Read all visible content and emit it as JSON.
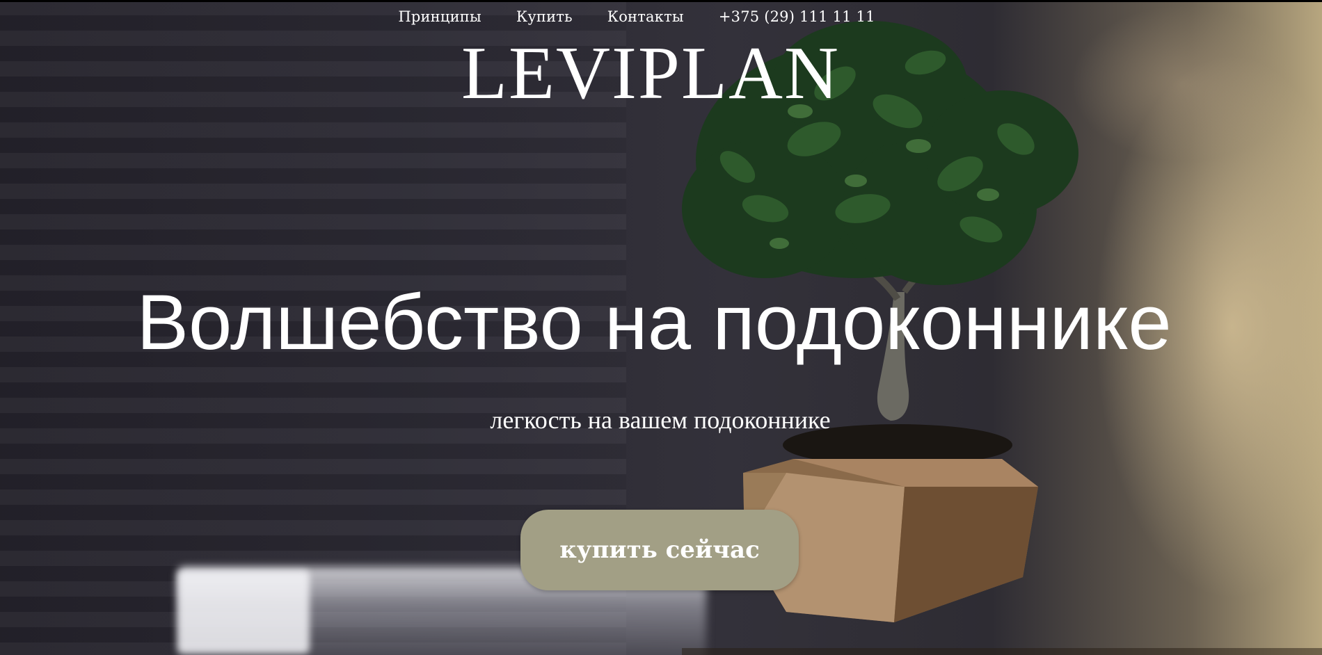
{
  "nav": {
    "items": [
      {
        "label": "Принципы"
      },
      {
        "label": "Купить"
      },
      {
        "label": "Контакты"
      }
    ],
    "phone": "+375 (29) 111 11 11"
  },
  "logo": {
    "text": "LEVIPLAN"
  },
  "hero": {
    "headline": "Волшебство на подоконнике",
    "subheadline": "легкость на вашем подоконнике",
    "cta_label": "купить сейчас",
    "cta_color": "#a29f85"
  },
  "colors": {
    "text": "#ffffff",
    "background_dark": "#2b2933",
    "window_light": "#b7a67f"
  }
}
